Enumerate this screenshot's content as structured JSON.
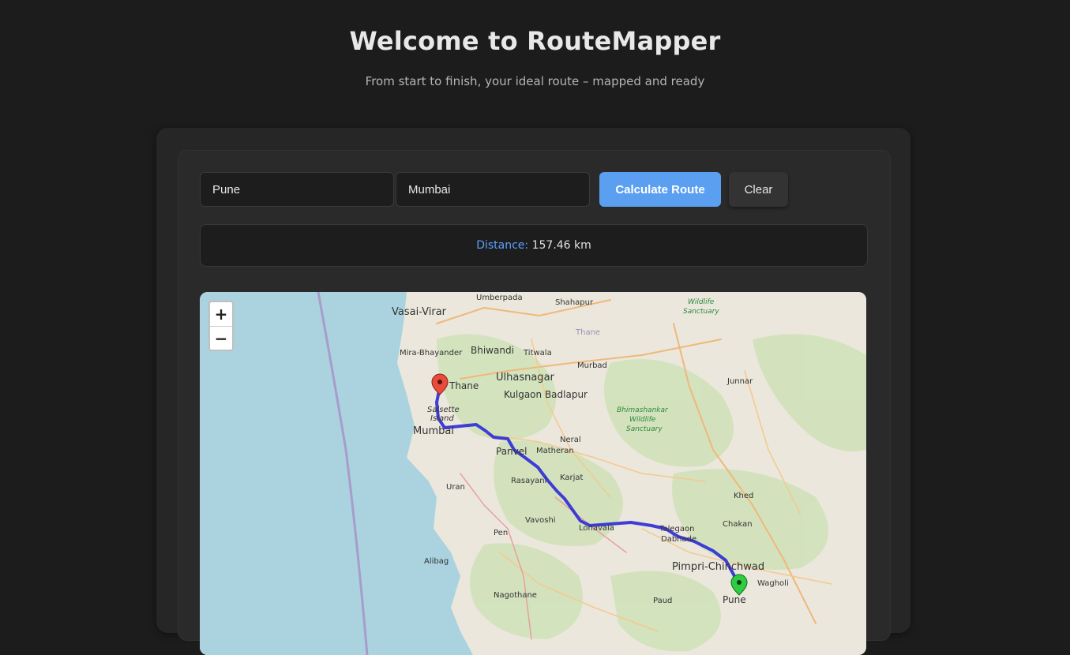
{
  "header": {
    "title": "Welcome to RouteMapper",
    "subtitle": "From start to finish, your ideal route – mapped and ready"
  },
  "form": {
    "start_value": "Pune",
    "end_value": "Mumbai",
    "calculate_label": "Calculate Route",
    "clear_label": "Clear"
  },
  "result": {
    "distance_label": "Distance:",
    "distance_value": "157.46 km"
  },
  "map": {
    "zoom_in": "+",
    "zoom_out": "−",
    "start_marker_color": "#e74c3c",
    "end_marker_color": "#2ecc40",
    "route_color": "#2b2bd6",
    "places": {
      "umberpada": "Umberpada",
      "shahapur": "Shahapur",
      "vasai_virar": "Vasai-Virar",
      "mira_bhayander": "Mira-Bhayander",
      "bhiwandi": "Bhiwandi",
      "titwala": "Titwala",
      "thane_district": "Thane",
      "ulhasnagar": "Ulhasnagar",
      "murbad": "Murbad",
      "thane": "Thane",
      "kulgaon_badlapur": "Kulgaon Badlapur",
      "junnar": "Junnar",
      "salsette_1": "Salsette",
      "salsette_2": "Island",
      "mumbai": "Mumbai",
      "neral": "Neral",
      "panvel": "Panvel",
      "matheran": "Matheran",
      "rasayani": "Rasayani",
      "karjat": "Karjat",
      "uran": "Uran",
      "khed": "Khed",
      "vavoshi": "Vavoshi",
      "lonavala": "Lonavala",
      "talegaon": "Talegaon",
      "chakan": "Chakan",
      "pen": "Pen",
      "dabhade": "Dabhade",
      "alibag": "Alibag",
      "pimpri_chinchwad": "Pimpri-Chinchwad",
      "wagholi": "Wagholi",
      "nagothane": "Nagothane",
      "paud": "Paud",
      "pune": "Pune"
    },
    "parks": {
      "bhimashankar_1": "Bhimashankar",
      "bhimashankar_2": "Wildlife",
      "bhimashankar_3": "Sanctuary",
      "north_1": "Wildlife",
      "north_2": "Sanctuary"
    }
  }
}
